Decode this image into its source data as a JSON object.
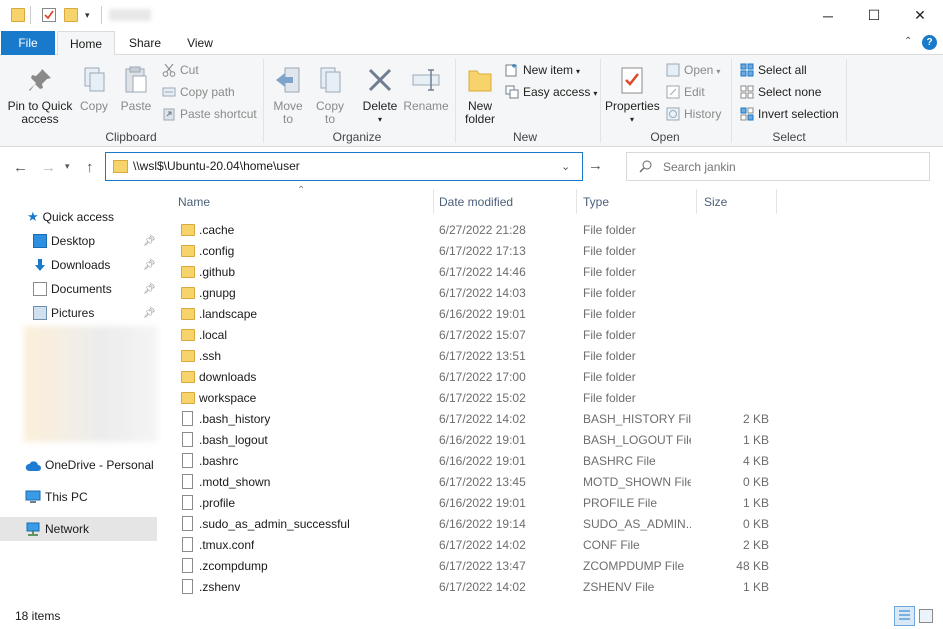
{
  "titlebar": {
    "quick_access_icons": [
      "folder-icon",
      "properties-check-icon",
      "new-folder-icon",
      "customize-dropdown-icon"
    ],
    "window_controls": {
      "minimize": "─",
      "maximize": "☐",
      "close": "✕"
    }
  },
  "tabs": [
    {
      "label": "File"
    },
    {
      "label": "Home"
    },
    {
      "label": "Share"
    },
    {
      "label": "View"
    }
  ],
  "ribbon": {
    "clipboard": {
      "group_label": "Clipboard",
      "pin_label_1": "Pin to Quick",
      "pin_label_2": "access",
      "copy_label": "Copy",
      "paste_label": "Paste",
      "cut_label": "Cut",
      "copy_path_label": "Copy path",
      "paste_shortcut_label": "Paste shortcut"
    },
    "organize": {
      "group_label": "Organize",
      "move_to_1": "Move",
      "move_to_2": "to",
      "copy_to_1": "Copy",
      "copy_to_2": "to",
      "delete_label": "Delete",
      "rename_label": "Rename"
    },
    "new": {
      "group_label": "New",
      "new_folder_1": "New",
      "new_folder_2": "folder",
      "new_item_label": "New item",
      "easy_access_label": "Easy access"
    },
    "open": {
      "group_label": "Open",
      "properties_label": "Properties",
      "open_label": "Open",
      "edit_label": "Edit",
      "history_label": "History"
    },
    "select": {
      "group_label": "Select",
      "select_all_label": "Select all",
      "select_none_label": "Select none",
      "invert_selection_label": "Invert selection"
    }
  },
  "address": {
    "path": "\\\\wsl$\\Ubuntu-20.04\\home\\user",
    "search_placeholder": "Search jankin"
  },
  "navpane": {
    "quick_access": "Quick access",
    "items": [
      {
        "label": "Desktop"
      },
      {
        "label": "Downloads"
      },
      {
        "label": "Documents"
      },
      {
        "label": "Pictures"
      }
    ],
    "onedrive": "OneDrive - Personal",
    "this_pc": "This PC",
    "network": "Network"
  },
  "columns": {
    "name": "Name",
    "date": "Date modified",
    "type": "Type",
    "size": "Size"
  },
  "files": [
    {
      "name": ".cache",
      "date": "6/27/2022 21:28",
      "type": "File folder",
      "size": "",
      "kind": "folder"
    },
    {
      "name": ".config",
      "date": "6/17/2022 17:13",
      "type": "File folder",
      "size": "",
      "kind": "folder"
    },
    {
      "name": ".github",
      "date": "6/17/2022 14:46",
      "type": "File folder",
      "size": "",
      "kind": "folder"
    },
    {
      "name": ".gnupg",
      "date": "6/17/2022 14:03",
      "type": "File folder",
      "size": "",
      "kind": "folder"
    },
    {
      "name": ".landscape",
      "date": "6/16/2022 19:01",
      "type": "File folder",
      "size": "",
      "kind": "folder"
    },
    {
      "name": ".local",
      "date": "6/17/2022 15:07",
      "type": "File folder",
      "size": "",
      "kind": "folder"
    },
    {
      "name": ".ssh",
      "date": "6/17/2022 13:51",
      "type": "File folder",
      "size": "",
      "kind": "folder"
    },
    {
      "name": "downloads",
      "date": "6/17/2022 17:00",
      "type": "File folder",
      "size": "",
      "kind": "folder"
    },
    {
      "name": "workspace",
      "date": "6/17/2022 15:02",
      "type": "File folder",
      "size": "",
      "kind": "folder"
    },
    {
      "name": ".bash_history",
      "date": "6/17/2022 14:02",
      "type": "BASH_HISTORY File",
      "size": "2 KB",
      "kind": "file"
    },
    {
      "name": ".bash_logout",
      "date": "6/16/2022 19:01",
      "type": "BASH_LOGOUT File",
      "size": "1 KB",
      "kind": "file"
    },
    {
      "name": ".bashrc",
      "date": "6/16/2022 19:01",
      "type": "BASHRC File",
      "size": "4 KB",
      "kind": "file"
    },
    {
      "name": ".motd_shown",
      "date": "6/17/2022 13:45",
      "type": "MOTD_SHOWN File",
      "size": "0 KB",
      "kind": "file"
    },
    {
      "name": ".profile",
      "date": "6/16/2022 19:01",
      "type": "PROFILE File",
      "size": "1 KB",
      "kind": "file"
    },
    {
      "name": ".sudo_as_admin_successful",
      "date": "6/16/2022 19:14",
      "type": "SUDO_AS_ADMIN...",
      "size": "0 KB",
      "kind": "file"
    },
    {
      "name": ".tmux.conf",
      "date": "6/17/2022 14:02",
      "type": "CONF File",
      "size": "2 KB",
      "kind": "file"
    },
    {
      "name": ".zcompdump",
      "date": "6/17/2022 13:47",
      "type": "ZCOMPDUMP File",
      "size": "48 KB",
      "kind": "file"
    },
    {
      "name": ".zshenv",
      "date": "6/17/2022 14:02",
      "type": "ZSHENV File",
      "size": "1 KB",
      "kind": "file"
    }
  ],
  "status": {
    "item_count": "18 items"
  },
  "colors": {
    "accent": "#1979ca",
    "folder": "#f6d36b",
    "selected_nav": "#e5e5e5"
  }
}
